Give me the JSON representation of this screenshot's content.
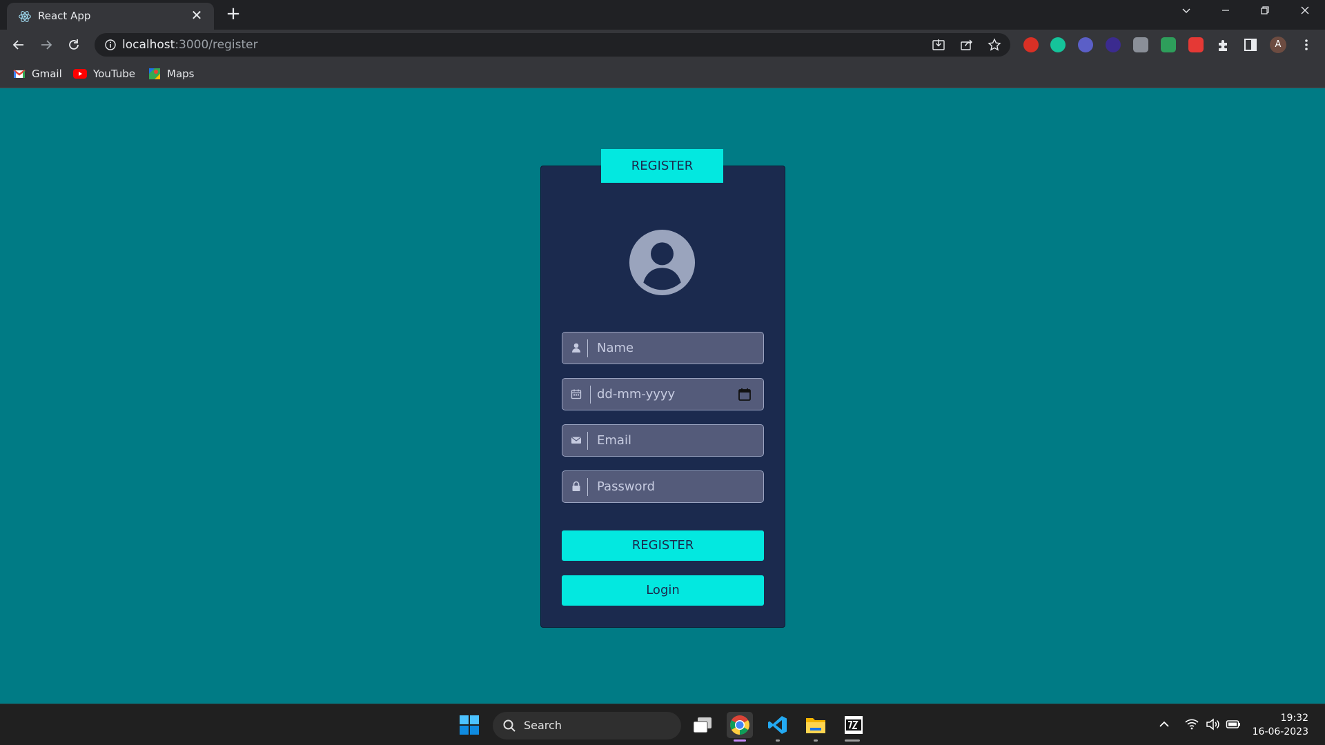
{
  "browser": {
    "tab_title": "React App",
    "tab_close": "✕",
    "new_tab": "+",
    "url_host": "localhost",
    "url_path": ":3000/register",
    "avatar_initial": "A",
    "bookmarks": [
      {
        "label": "Gmail"
      },
      {
        "label": "YouTube"
      },
      {
        "label": "Maps"
      }
    ]
  },
  "form": {
    "header": "REGISTER",
    "name_placeholder": "Name",
    "dob_placeholder": "dd-mm-yyyy",
    "email_placeholder": "Email",
    "password_placeholder": "Password",
    "register_button": "REGISTER",
    "login_button": "Login"
  },
  "taskbar": {
    "search_label": "Search",
    "time": "19:32",
    "date": "16-06-2023"
  },
  "colors": {
    "page_bg": "#007b85",
    "card_bg": "#1b2a4e",
    "accent": "#03e8e0",
    "input_bg": "#545b7a"
  }
}
